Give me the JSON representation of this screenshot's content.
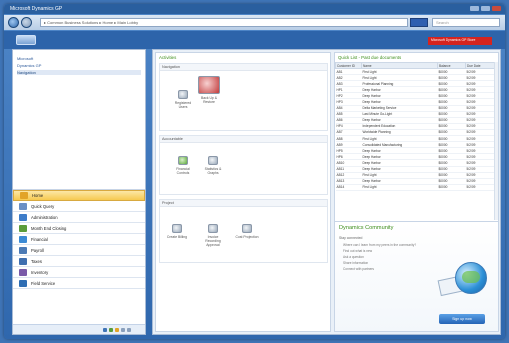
{
  "window": {
    "title": "Microsoft Dynamics GP"
  },
  "address": {
    "path": "▸ Common Business Solutions ▸ Home ▸ Main Lobby",
    "search_placeholder": "Search"
  },
  "toolbar": {
    "red_button_label": "Microsoft Dynamics GP Store"
  },
  "sidebar": {
    "tree": [
      "Microsoft",
      "Dynamics GP",
      "Navigation"
    ],
    "items": [
      {
        "label": "Home",
        "color": "#e2a428"
      },
      {
        "label": "Quick Query",
        "color": "#6b8fc4"
      },
      {
        "label": "Administration",
        "color": "#3d7cc9"
      },
      {
        "label": "Month End Closing",
        "color": "#5b9c3a"
      },
      {
        "label": "Financial",
        "color": "#3b8ad4"
      },
      {
        "label": "Payroll",
        "color": "#4b7ab5"
      },
      {
        "label": "Taxes",
        "color": "#3f6fb0"
      },
      {
        "label": "Inventory",
        "color": "#7a5aa8"
      },
      {
        "label": "Field Service",
        "color": "#2e6db3"
      }
    ]
  },
  "main": {
    "panel_title": "Activities",
    "sections": [
      {
        "title": "Navigation",
        "tiles": [
          "Registered Users",
          "Back Up & Restore"
        ]
      },
      {
        "title": "Accountable",
        "tiles": [
          "Financial Controls",
          "Statistics & Graphs"
        ]
      },
      {
        "title": "Project",
        "tiles": [
          "Create Billing",
          "Invoice Recording Approval",
          "Cost Projection"
        ]
      }
    ],
    "quick_list_title": "Quick List - Past due documents",
    "columns": [
      "Customer ID",
      "Name",
      "Balance",
      "Due Date"
    ],
    "rows": [
      [
        "AB1",
        "First Light",
        "$0000",
        "5/2/09"
      ],
      [
        "AB2",
        "First Light",
        "$0000",
        "5/2/09"
      ],
      [
        "AB3",
        "Professional Planning",
        "$0000",
        "5/2/09"
      ],
      [
        "HP1",
        "Deep Harbor",
        "$0000",
        "5/2/09"
      ],
      [
        "HP2",
        "Deep Harbor",
        "$0000",
        "5/2/09"
      ],
      [
        "HP3",
        "Deep Harbor",
        "$0000",
        "5/2/09"
      ],
      [
        "AB4",
        "Delta Marketing Service",
        "$0000",
        "5/2/09"
      ],
      [
        "AB5",
        "Last Minute Go-Light",
        "$0000",
        "5/2/09"
      ],
      [
        "AB6",
        "Deep Harbor",
        "$0000",
        "5/2/09"
      ],
      [
        "HP4",
        "Independent Education",
        "$0000",
        "5/2/09"
      ],
      [
        "AB7",
        "Worldwide Planning",
        "$0000",
        "5/2/09"
      ],
      [
        "AB8",
        "First Light",
        "$0000",
        "5/2/09"
      ],
      [
        "AB9",
        "Consolidated Manufacturing",
        "$0000",
        "5/2/09"
      ],
      [
        "HP5",
        "Deep Harbor",
        "$0000",
        "5/2/09"
      ],
      [
        "HP6",
        "Deep Harbor",
        "$0000",
        "5/2/09"
      ],
      [
        "AB10",
        "Deep Harbor",
        "$0000",
        "5/2/09"
      ],
      [
        "AB11",
        "Deep Harbor",
        "$0000",
        "5/2/09"
      ],
      [
        "AB12",
        "First Light",
        "$0000",
        "5/2/09"
      ],
      [
        "AB13",
        "Deep Harbor",
        "$0000",
        "5/2/09"
      ],
      [
        "AB14",
        "First Light",
        "$0000",
        "5/2/09"
      ]
    ],
    "community": {
      "title": "Dynamics Community",
      "subtitle": "Stay connected",
      "lines": [
        "Where can I learn from my peers in the community?",
        "Find out what is new",
        "Ask a question",
        "Share information",
        "Connect with partners"
      ],
      "button": "Sign up now"
    }
  }
}
